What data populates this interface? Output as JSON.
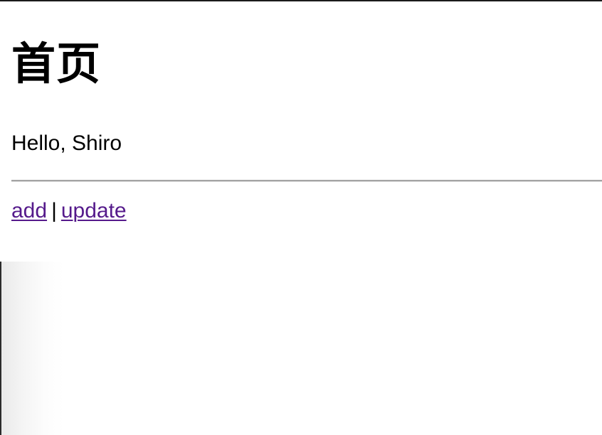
{
  "page": {
    "title": "首页",
    "greeting": "Hello, Shiro"
  },
  "links": {
    "add_label": "add",
    "separator": "|",
    "update_label": "update"
  },
  "colors": {
    "visited_link": "#551a8b",
    "text": "#000000",
    "divider": "#a4a4a4",
    "background": "#ffffff"
  }
}
